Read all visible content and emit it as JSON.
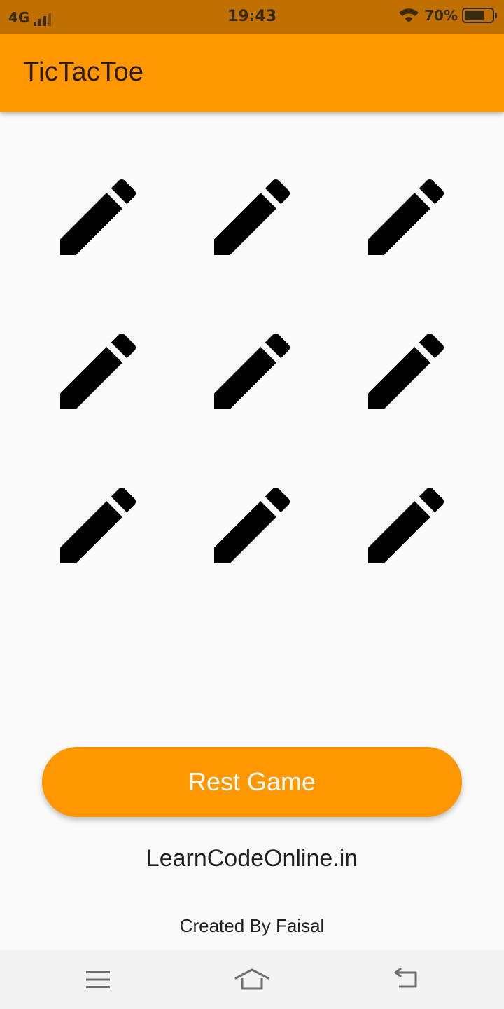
{
  "status_bar": {
    "network": "4G",
    "time": "19:43",
    "battery": "70%",
    "battery_level": 0.7
  },
  "app_bar": {
    "title": "TicTacToe",
    "color": "#ff9800"
  },
  "board": {
    "cells": [
      "pencil-icon",
      "pencil-icon",
      "pencil-icon",
      "pencil-icon",
      "pencil-icon",
      "pencil-icon",
      "pencil-icon",
      "pencil-icon",
      "pencil-icon"
    ]
  },
  "actions": {
    "reset_label": "Rest Game"
  },
  "footer": {
    "site": "LearnCodeOnline.in",
    "credit": "Created By Faisal"
  },
  "nav": {
    "icons": [
      "menu-icon",
      "home-icon",
      "back-icon"
    ]
  }
}
